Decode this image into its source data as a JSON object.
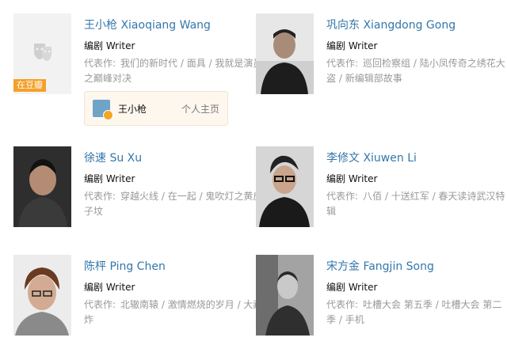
{
  "people": [
    {
      "id": "wang",
      "name": "王小枪 Xiaoqiang Wang",
      "role": "编剧 Writer",
      "works_label": "代表作:",
      "works": [
        "我们的新时代",
        "面具",
        "我就是演员之巅峰对决"
      ],
      "placeholder": true,
      "douban_tag": "在豆瓣",
      "personal": {
        "name": "王小枪",
        "link": "个人主页"
      }
    },
    {
      "id": "gong",
      "name": "巩向东 Xiangdong Gong",
      "role": "编剧 Writer",
      "works_label": "代表作:",
      "works": [
        "巡回检察组",
        "陆小凤传奇之绣花大盗",
        "新编辑部故事"
      ]
    },
    {
      "id": "xu",
      "name": "徐速 Su Xu",
      "role": "编剧 Writer",
      "works_label": "代表作:",
      "works": [
        "穿越火线",
        "在一起",
        "鬼吹灯之黄皮子坟"
      ]
    },
    {
      "id": "li",
      "name": "李修文 Xiuwen Li",
      "role": "编剧 Writer",
      "works_label": "代表作:",
      "works": [
        "八佰",
        "十送红军",
        "春天读诗武汉特辑"
      ]
    },
    {
      "id": "chen",
      "name": "陈枰 Ping Chen",
      "role": "编剧 Writer",
      "works_label": "代表作:",
      "works": [
        "北辙南辕",
        "激情燃烧的岁月",
        "大藏炸"
      ]
    },
    {
      "id": "song",
      "name": "宋方金 Fangjin Song",
      "role": "编剧 Writer",
      "works_label": "代表作:",
      "works": [
        "吐槽大会 第五季",
        "吐槽大会 第二季",
        "手机"
      ]
    }
  ],
  "colors": {
    "link": "#3377aa",
    "muted": "#999999",
    "tag": "#f4a02a"
  }
}
